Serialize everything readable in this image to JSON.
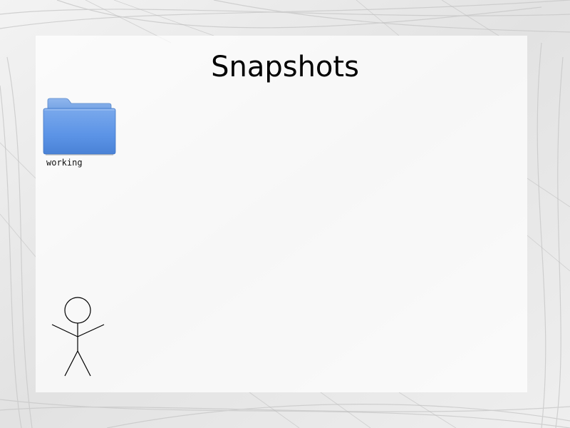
{
  "slide": {
    "title": "Snapshots"
  },
  "desktop": {
    "items": [
      {
        "label": "working",
        "icon": "folder-icon",
        "color": "#5b93e6"
      }
    ]
  },
  "illustration": {
    "icon": "stick-figure-icon"
  },
  "colors": {
    "background": "#e9e9e9",
    "slide_background": "#ffffff",
    "folder_blue": "#5b93e6"
  }
}
